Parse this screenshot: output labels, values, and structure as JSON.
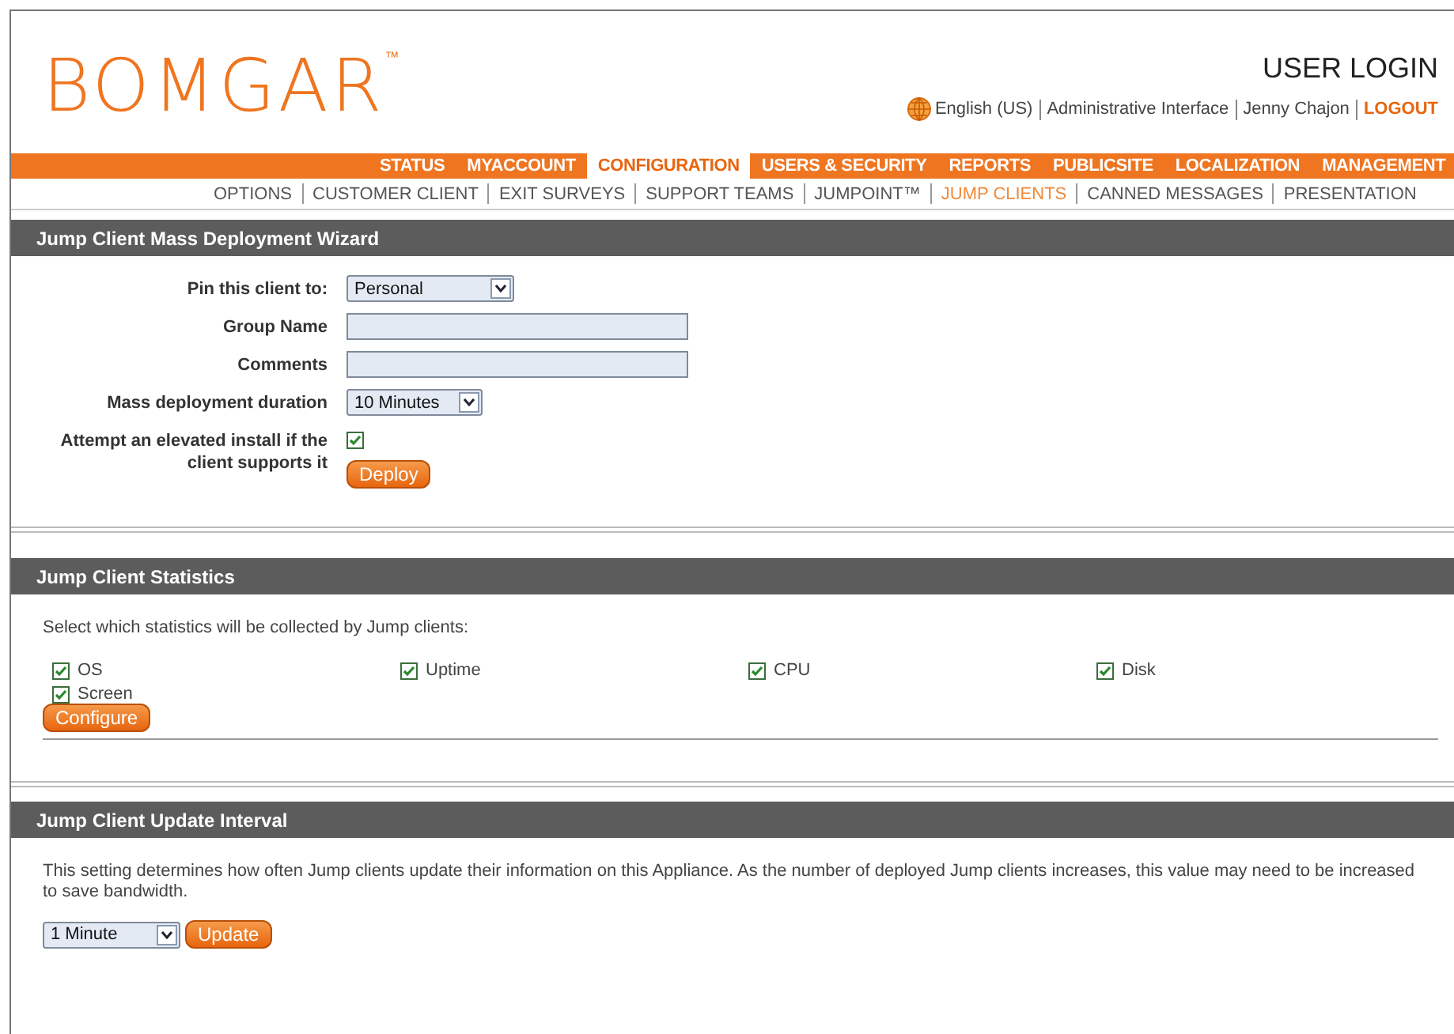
{
  "header": {
    "logo": "BOMGAR",
    "trademark": "™",
    "title": "USER LOGIN",
    "links": [
      {
        "label": "English (US)",
        "kind": "language"
      },
      {
        "label": "Administrative Interface",
        "kind": "link"
      },
      {
        "label": "Jenny Chajon",
        "kind": "link"
      },
      {
        "label": "LOGOUT",
        "kind": "logout"
      }
    ]
  },
  "nav": [
    {
      "label": "STATUS",
      "selected": false
    },
    {
      "label": "MYACCOUNT",
      "selected": false
    },
    {
      "label": "CONFIGURATION",
      "selected": true
    },
    {
      "label": "USERS & SECURITY",
      "selected": false
    },
    {
      "label": "REPORTS",
      "selected": false
    },
    {
      "label": "PUBLICSITE",
      "selected": false
    },
    {
      "label": "LOCALIZATION",
      "selected": false
    },
    {
      "label": "MANAGEMENT",
      "selected": false
    }
  ],
  "subnav": [
    {
      "label": "OPTIONS",
      "selected": false
    },
    {
      "label": "CUSTOMER CLIENT",
      "selected": false
    },
    {
      "label": "EXIT SURVEYS",
      "selected": false
    },
    {
      "label": "SUPPORT TEAMS",
      "selected": false
    },
    {
      "label": "JUMPOINT™",
      "selected": false
    },
    {
      "label": "JUMP CLIENTS",
      "selected": true
    },
    {
      "label": "CANNED MESSAGES",
      "selected": false
    },
    {
      "label": "PRESENTATION",
      "selected": false
    }
  ],
  "wizard": {
    "title": "Jump Client Mass Deployment Wizard",
    "fields": [
      {
        "kind": "select",
        "label": "Pin this client to:",
        "value": "Personal"
      },
      {
        "kind": "text",
        "label": "Group Name"
      },
      {
        "kind": "text",
        "label": "Comments"
      },
      {
        "kind": "select",
        "label": "Mass deployment duration",
        "value": "10 Minutes"
      },
      {
        "kind": "checkbox",
        "label": "Attempt an elevated install if the client supports it",
        "checked": true
      }
    ],
    "button": "Deploy"
  },
  "statistics": {
    "title": "Jump Client Statistics",
    "intro": "Select which statistics will be collected by Jump clients:",
    "options": [
      {
        "label": "OS",
        "checked": true
      },
      {
        "label": "Uptime",
        "checked": true
      },
      {
        "label": "CPU",
        "checked": true
      },
      {
        "label": "Disk",
        "checked": true
      },
      {
        "label": "Screen",
        "checked": true
      }
    ],
    "button": "Configure"
  },
  "interval": {
    "title": "Jump Client Update Interval",
    "description": "This setting determines how often Jump clients update their information on this Appliance. As the number of deployed Jump clients increases, this value may need to be increased to save bandwidth.",
    "value": "1 Minute",
    "button": "Update"
  }
}
